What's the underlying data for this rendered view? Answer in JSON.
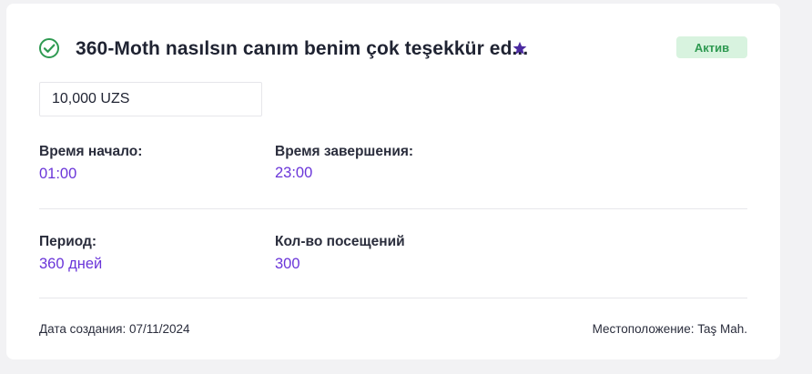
{
  "card": {
    "title": "360-Moth nasılsın canım benim çok teşekkür ed...",
    "status_badge": "Актив",
    "price": "10,000 UZS",
    "start_time": {
      "label": "Время начало:",
      "value": "01:00"
    },
    "end_time": {
      "label": "Время завершения:",
      "value": "23:00"
    },
    "period": {
      "label": "Период:",
      "value": "360 дней"
    },
    "visits": {
      "label": "Кол-во посещений",
      "value": "300"
    },
    "created": "Дата создания: 07/11/2024",
    "location": "Местоположение: Taş Mah."
  },
  "icons": {
    "status": "check-circle-icon",
    "favorite": "star-icon"
  },
  "colors": {
    "accent": "#6a35d9",
    "success": "#2f9a52",
    "badge_bg": "#d8f3df",
    "star": "#4b2aa0"
  }
}
